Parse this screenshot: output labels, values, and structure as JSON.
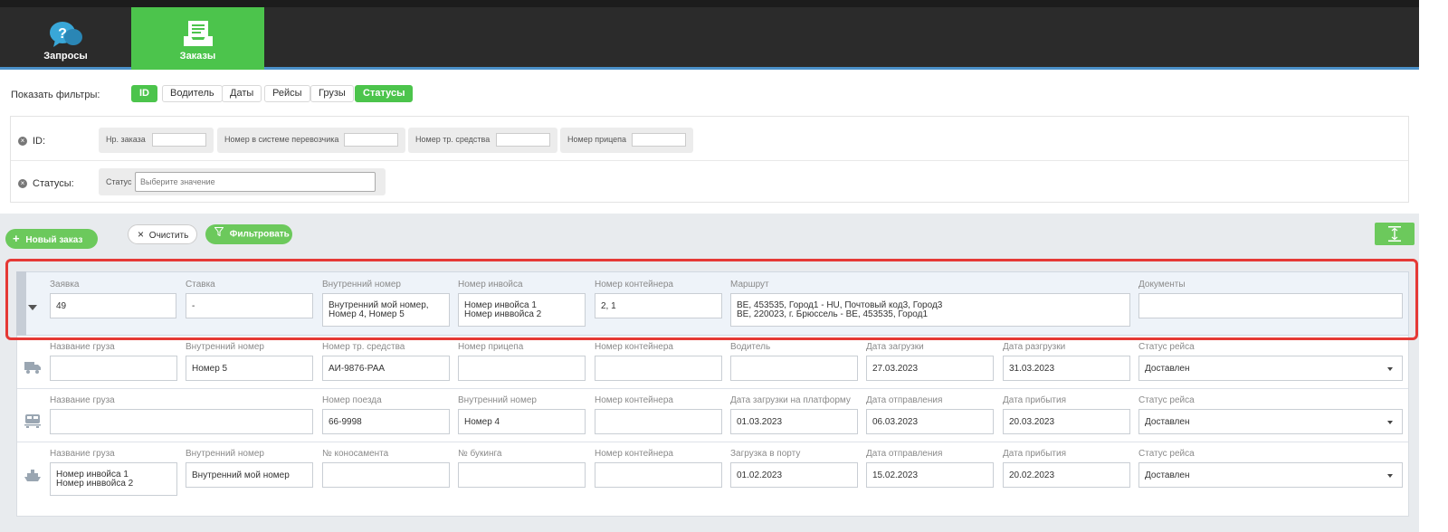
{
  "nav": {
    "requests": "Запросы",
    "orders": "Заказы"
  },
  "filters": {
    "show_label": "Показать фильтры:",
    "chips": [
      "ID",
      "Водитель",
      "Даты",
      "Рейсы",
      "Грузы",
      "Статусы"
    ],
    "id_row": {
      "label": "ID:",
      "fields": [
        "Нр. заказа",
        "Номер в системе перевозчика",
        "Номер тр. средства",
        "Номер прицепа"
      ]
    },
    "status_row": {
      "label": "Статусы:",
      "field_label": "Статус",
      "placeholder": "Выберите значение"
    }
  },
  "actions": {
    "new_order": "Новый заказ",
    "clear": "Очистить",
    "filter": "Фильтровать"
  },
  "order": {
    "headers": [
      "Заявка",
      "Ставка",
      "Внутренний номер",
      "Номер инвойса",
      "Номер контейнера",
      "Маршрут",
      "Документы"
    ],
    "values": {
      "request": "49",
      "rate": "-",
      "internal_1": "Внутренний мой номер,",
      "internal_2": "Номер 4, Номер 5",
      "invoice_1": "Номер инвойса 1",
      "invoice_2": "Номер инввойса 2",
      "container": "2, 1",
      "route_1": "BE, 453535, Город1 - HU, Почтовый код3, Город3",
      "route_2": "BE, 220023, г. Брюссель - BE, 453535, Город1",
      "documents": ""
    }
  },
  "legs": [
    {
      "icon": "truck-icon",
      "labels": [
        "Название груза",
        "Внутренний номер",
        "Номер тр. средства",
        "Номер прицепа",
        "Номер контейнера",
        "Водитель",
        "Дата загрузки",
        "Дата разгрузки",
        "Статус рейса"
      ],
      "values": [
        "",
        "Номер 5",
        "АИ-9876-РАА",
        "",
        "",
        "",
        "27.03.2023",
        "31.03.2023",
        "Доставлен"
      ]
    },
    {
      "icon": "train-icon",
      "labels": [
        "Название груза",
        "",
        "Номер поезда",
        "Внутренний номер",
        "Номер контейнера",
        "Дата загрузки на платформу",
        "Дата отправления",
        "Дата прибытия",
        "Статус рейса"
      ],
      "values": [
        "",
        "",
        "66-9998",
        "Номер 4",
        "",
        "01.03.2023",
        "06.03.2023",
        "20.03.2023",
        "Доставлен"
      ]
    },
    {
      "icon": "ship-icon",
      "labels": [
        "Название груза",
        "Внутренний номер",
        "№ коносамента",
        "№ букинга",
        "Номер контейнера",
        "Загрузка в порту",
        "Дата отправления",
        "Дата прибытия",
        "Статус рейса"
      ],
      "values_cargo_1": "Номер инвойса 1",
      "values_cargo_2": "Номер инввойса 2",
      "values": [
        "",
        "Внутренний мой номер",
        "",
        "",
        "",
        "01.02.2023",
        "15.02.2023",
        "20.02.2023",
        "Доставлен"
      ]
    }
  ]
}
